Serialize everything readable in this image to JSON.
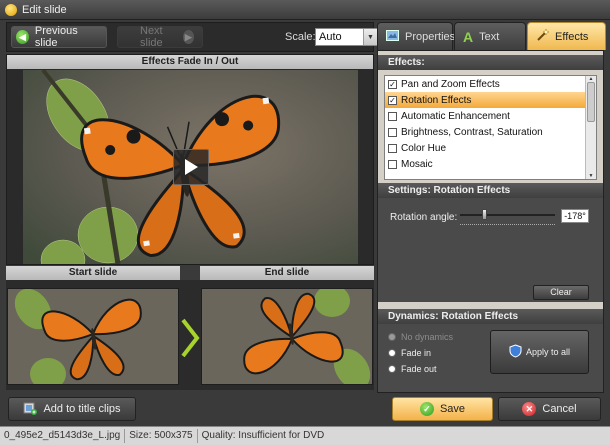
{
  "window": {
    "title": "Edit slide"
  },
  "toolbar": {
    "previous_label": "Previous slide",
    "next_label": "Next slide",
    "scale_label": "Scale:",
    "scale_value": "Auto"
  },
  "preview": {
    "header": "Effects Fade In / Out",
    "start_label": "Start slide",
    "end_label": "End slide"
  },
  "tabs": [
    {
      "label": "Properties"
    },
    {
      "label": "Text"
    },
    {
      "label": "Effects"
    }
  ],
  "effects": {
    "header": "Effects:",
    "items": [
      {
        "label": "Pan and Zoom Effects",
        "checked": true,
        "selected": false
      },
      {
        "label": "Rotation Effects",
        "checked": true,
        "selected": true
      },
      {
        "label": "Automatic Enhancement",
        "checked": false,
        "selected": false
      },
      {
        "label": "Brightness, Contrast, Saturation",
        "checked": false,
        "selected": false
      },
      {
        "label": "Color Hue",
        "checked": false,
        "selected": false
      },
      {
        "label": "Mosaic",
        "checked": false,
        "selected": false
      }
    ]
  },
  "settings": {
    "header": "Settings: Rotation Effects",
    "angle_label": "Rotation angle:",
    "angle_value": "-178°",
    "clear_label": "Clear"
  },
  "dynamics": {
    "header": "Dynamics: Rotation Effects",
    "options": [
      {
        "label": "No dynamics",
        "disabled": true
      },
      {
        "label": "Fade in",
        "disabled": false,
        "selected": true
      },
      {
        "label": "Fade out",
        "disabled": false,
        "selected": false
      }
    ],
    "apply_label": "Apply to all"
  },
  "buttons": {
    "add_title_clips": "Add to title clips",
    "save": "Save",
    "cancel": "Cancel"
  },
  "status": {
    "file": "0_495e2_d5143d3e_L.jpg",
    "size": "Size: 500x375",
    "quality": "Quality: Insufficient for DVD"
  },
  "colors": {
    "accent": "#f4b24a",
    "selection": "#f4a93a",
    "success": "#2f9a1a",
    "cancel": "#d9262b"
  }
}
